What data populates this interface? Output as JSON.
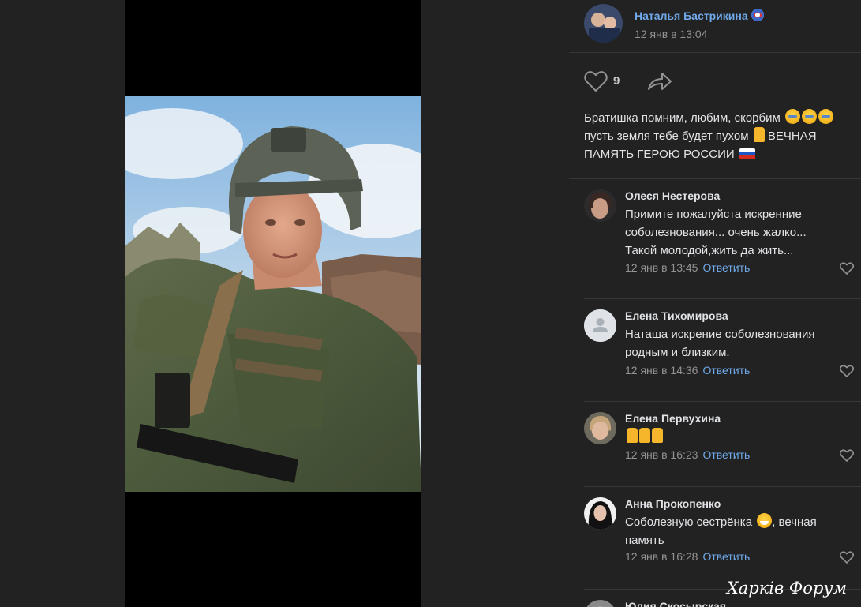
{
  "post": {
    "author_name": "Наталья Бастрикина",
    "time": "12 янв в 13:04",
    "likes": "9",
    "text_lines": [
      "Братишка помним, любим, скорбим",
      "пусть земля тебе будет пухом",
      "ВЕЧНАЯ",
      "ПАМЯТЬ ГЕРОЮ РОССИИ"
    ]
  },
  "comments": [
    {
      "name": "Олеся Нестерова",
      "text_lines": [
        "Примите пожалуйста искренние",
        "соболезнования... очень жалко...",
        "Такой молодой,жить да жить..."
      ],
      "time": "12 янв в 13:45",
      "reply": "Ответить"
    },
    {
      "name": "Елена Тихомирова",
      "text_lines": [
        "Наташа искрение соболезнования",
        "родным и близким."
      ],
      "time": "12 янв в 14:36",
      "reply": "Ответить"
    },
    {
      "name": "Елена Первухина",
      "text_lines": [],
      "time": "12 янв в 16:23",
      "reply": "Ответить"
    },
    {
      "name": "Анна Прокопенко",
      "text_lines": [
        "Соболезную сестрёнка",
        ", вечная",
        "память"
      ],
      "time": "12 янв в 16:28",
      "reply": "Ответить"
    },
    {
      "name": "Юлия Скосырская",
      "text_lines": [],
      "time": "",
      "reply": ""
    }
  ],
  "watermark": "Харків Форум",
  "icons": {
    "like": "heart-outline-icon",
    "share": "share-arrow-icon",
    "default_avatar": "person-silhouette-icon"
  },
  "colors": {
    "background": "#222222",
    "link": "#71aaeb",
    "muted": "#939393",
    "text": "#e1e3e6"
  }
}
